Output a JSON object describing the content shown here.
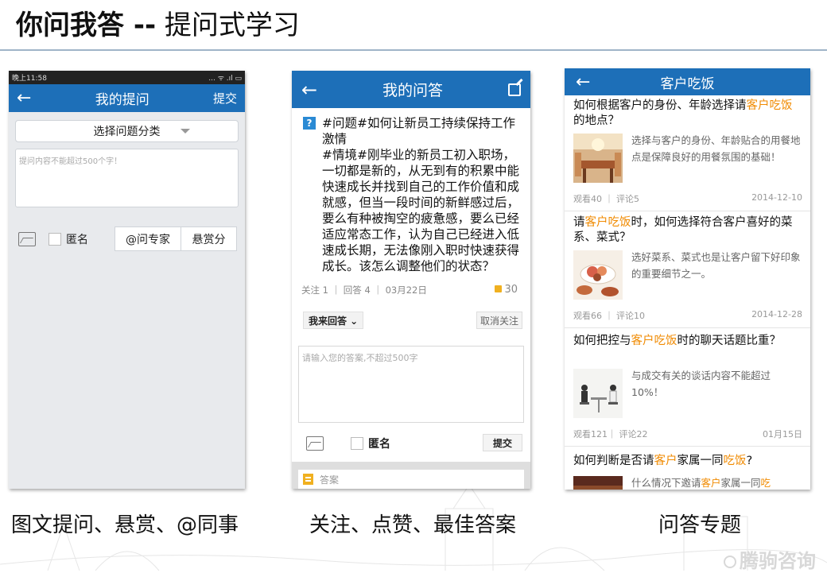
{
  "slide": {
    "title_bold": "你问我答 --",
    "title_rest": "提问式学习"
  },
  "captions": {
    "left": "图文提问、悬赏、@同事",
    "middle": "关注、点赞、最佳答案",
    "right": "问答专题"
  },
  "watermark": "腾驹咨询",
  "phone1": {
    "status_time": "晚上11:58",
    "status_icons": "... ᯤ .ıl ▭",
    "nav_back": "←",
    "nav_title": "我的提问",
    "nav_action": "提交",
    "category_select": "选择问题分类",
    "content_placeholder": "提问内容不能超过500个字！",
    "anonymous_label": "匿名",
    "ask_expert_button": "@问专家",
    "reward_button": "悬赏分"
  },
  "phone2": {
    "nav_back": "←",
    "nav_title": "我的问答",
    "question_badge": "?",
    "question_text": "#问题#如何让新员工持续保持工作激情\n#情境#刚毕业的新员工初入职场，一切都是新的，从无到有的积累中能快速成长并找到自己的工作价值和成就感，但当一段时间的新鲜感过后，要么有种被掏空的疲惫感，要么已经适应常态工作，认为自己已经进入低速成长期，无法像刚入职时快速获得成长。该怎么调整他们的状态？",
    "meta": "关注 1 ｜ 回答 4 ｜ 03月22日",
    "likes": "30",
    "answer_button": "我来回答 ⌄",
    "unfollow_button": "取消关注",
    "answer_placeholder": "请输入您的答案,不超过500字",
    "anonymous_label": "匿名",
    "submit_button": "提交",
    "answers_label": "答案"
  },
  "phone3": {
    "nav_back": "←",
    "nav_title": "客户吃饭",
    "topics": [
      {
        "title_pre": "如何根据客户的身份、年龄选择请",
        "title_hl": "客户吃饭",
        "title_post": "的地点？",
        "desc": "选择与客户的身份、年龄贴合的用餐地点是保障良好的用餐氛围的基础！",
        "meta": "观看40 ｜ 评论5",
        "date": "2014-12-10"
      },
      {
        "title_pre": "请",
        "title_hl": "客户吃饭",
        "title_post": "时，如何选择符合客户喜好的菜系、菜式？",
        "desc": "选好菜系、菜式也是让客户留下好印象的重要细节之一。",
        "meta": "观看66 ｜ 评论10",
        "date": "2014-12-28"
      },
      {
        "title_pre": "如何把控与",
        "title_hl": "客户吃饭",
        "title_post": "时的聊天话题比重？",
        "desc": "与成交有关的谈话内容不能超过10%！",
        "meta": "观看121｜ 评论22",
        "date": "01月15日"
      },
      {
        "title_pre": "如何判断是否请",
        "title_hl": "客户",
        "title_mid": "家属一同",
        "title_hl2": "吃饭",
        "title_post": "?",
        "desc_pre": "什么情况下邀请",
        "desc_hl": "客户",
        "desc_mid": "家属一同",
        "desc_hl2": "吃"
      }
    ]
  },
  "colors": {
    "nav_blue": "#1d6fb8",
    "highlight_orange": "#f08a00",
    "phone_gray": "#e8eaed"
  }
}
